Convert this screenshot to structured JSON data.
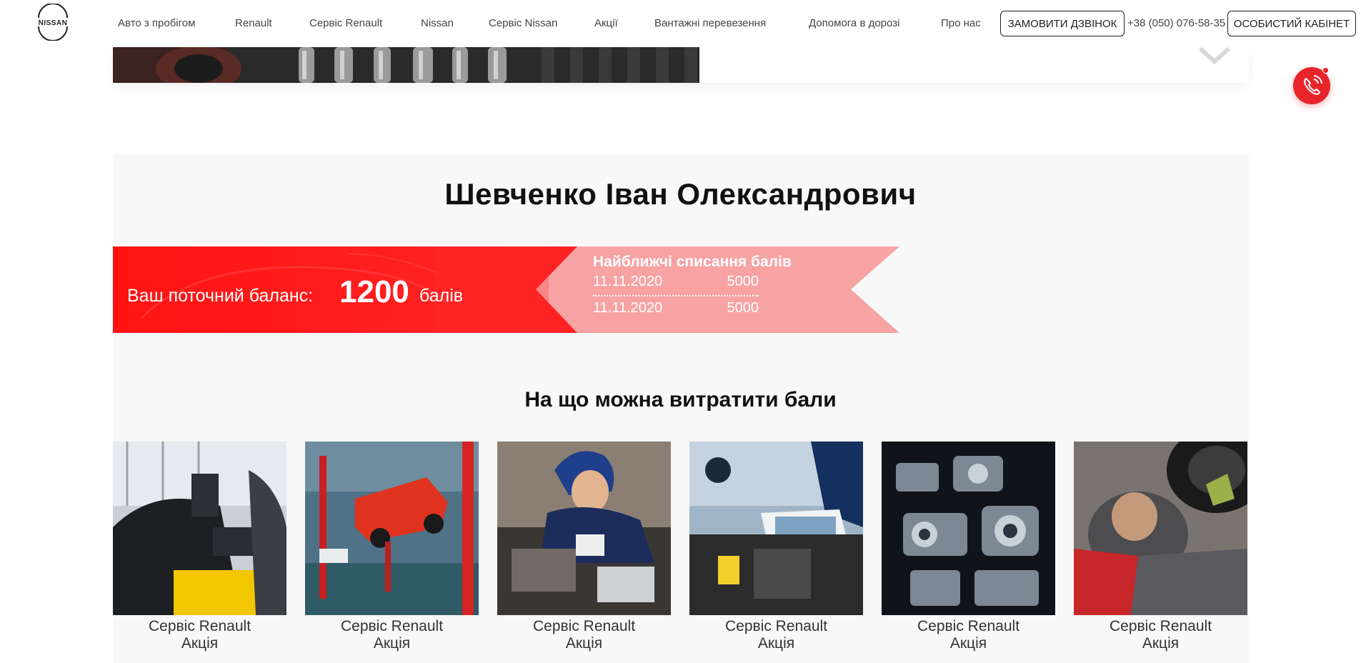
{
  "header": {
    "logo_text": "NISSAN",
    "nav": [
      "Авто з пробігом",
      "Renault",
      "Сервіс Renault",
      "Nissan",
      "Сервіс Nissan",
      "Акції",
      "Вантажні перевезення",
      "Допомога в дорозі",
      "Про нас"
    ],
    "callback_button": "ЗАМОВИТИ ДЗВІНОК",
    "phone": "+38 (050) 076-58-35",
    "account_button": "ОСОБИСТИЙ КАБІНЕТ"
  },
  "call_widget": {
    "icon": "phone-icon"
  },
  "profile": {
    "name": "Шевченко Іван Олександрович"
  },
  "balance": {
    "label": "Ваш поточний баланс:",
    "value": "1200",
    "unit": "балів"
  },
  "writeoffs": {
    "title": "Найближчі списання балів",
    "items": [
      {
        "date": "11.11.2020",
        "amount": "5000"
      },
      {
        "date": "11.11.2020",
        "amount": "5000"
      }
    ]
  },
  "offers": {
    "title": "На що можна витратити бали",
    "items": [
      {
        "line1": "Сервіс Renault",
        "line2": "Акція"
      },
      {
        "line1": "Сервіс Renault",
        "line2": "Акція"
      },
      {
        "line1": "Сервіс Renault",
        "line2": "Акція"
      },
      {
        "line1": "Сервіс Renault",
        "line2": "Акція"
      },
      {
        "line1": "Сервіс Renault",
        "line2": "Акція"
      },
      {
        "line1": "Сервіс Renault",
        "line2": "Акція"
      }
    ]
  },
  "colors": {
    "brand_red": "#ff1a1a",
    "ribbon_pink": "#f7a0a0",
    "call_red": "#e8242b",
    "card_bg": "#f8f8f8"
  }
}
